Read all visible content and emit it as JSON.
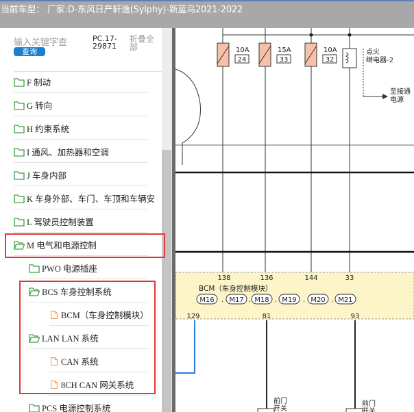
{
  "title": {
    "text": "当前车型：  厂家:D-东风日产轩逸(Sylphy)-新蓝鸟2021-2022"
  },
  "search": {
    "placeholder": "输入关键字查",
    "button_label": "查询",
    "version": "PC.17-29871",
    "collapse_all": "折叠全部"
  },
  "tree": {
    "items": [
      {
        "label": "F 制动",
        "icon": "folder-icon"
      },
      {
        "label": "G 转向",
        "icon": "folder-icon"
      },
      {
        "label": "H 约束系统",
        "icon": "folder-icon"
      },
      {
        "label": "I 通风、加热器和空调",
        "icon": "folder-icon"
      },
      {
        "label": "J 车身内部",
        "icon": "folder-icon"
      },
      {
        "label": "K 车身外部、车门、车顶和车辆安",
        "icon": "folder-icon"
      },
      {
        "label": "L 驾驶员控制装置",
        "icon": "folder-icon"
      },
      {
        "label": "M 电气和电源控制",
        "icon": "folder-open-icon"
      },
      {
        "label": "PWO 电源插座",
        "icon": "folder-icon"
      },
      {
        "label": "BCS 车身控制系统",
        "icon": "folder-open-icon"
      },
      {
        "label": "BCM（车身控制模块）",
        "icon": "document-icon"
      },
      {
        "label": "LAN LAN 系统",
        "icon": "folder-open-icon"
      },
      {
        "label": "CAN 系统",
        "icon": "document-icon"
      },
      {
        "label": "8CH CAN 网关系统",
        "icon": "document-icon"
      },
      {
        "label": "PCS 电源控制系统",
        "icon": "folder-icon"
      }
    ]
  },
  "diagram": {
    "fuses": [
      {
        "rating": "10A",
        "number": "24"
      },
      {
        "rating": "15A",
        "number": "33"
      },
      {
        "rating": "10A",
        "number": "32"
      }
    ],
    "relay": {
      "label_line1": "点火",
      "label_line2": "继电器-2"
    },
    "arrow_label": {
      "line1": "至接通",
      "line2": "电源"
    },
    "bcm": {
      "pins_top": [
        "138",
        "136",
        "144",
        "33"
      ],
      "title": "BCM（车身控制模块）",
      "connectors": [
        "M16",
        "M17",
        "M18",
        "M19",
        "M20",
        "M21"
      ],
      "pins_bottom": [
        "129",
        "81",
        "93"
      ]
    },
    "switches": [
      {
        "line1": "前门",
        "line2": "开关"
      },
      {
        "line1": "前门",
        "line2": "开关"
      }
    ]
  },
  "colors": {
    "highlight": "#e03838",
    "fuse_fill": "#f8c0a8",
    "bcm_fill": "#fdf5c8",
    "wire_blue": "#2a7ad8",
    "button_blue": "#1a7fd0"
  }
}
